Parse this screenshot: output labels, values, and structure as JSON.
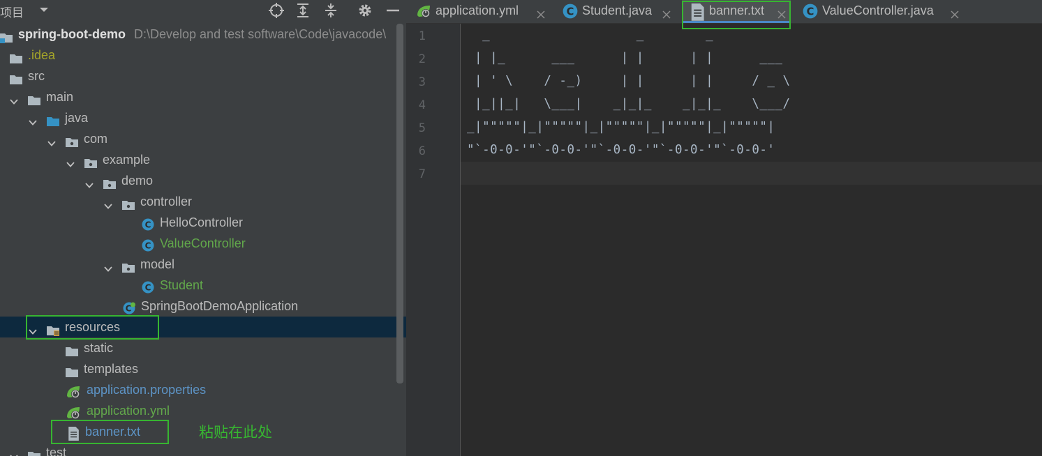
{
  "project_panel": {
    "title": "项目",
    "tree": [
      {
        "label": "spring-boot-demo",
        "path": "D:\\Develop and test software\\Code\\javacode\\",
        "icon": "module-folder-icon"
      },
      {
        "label": ".idea",
        "icon": "folder-icon"
      },
      {
        "label": "src",
        "icon": "folder-icon"
      },
      {
        "label": "main",
        "icon": "folder-icon"
      },
      {
        "label": "java",
        "icon": "source-folder-icon"
      },
      {
        "label": "com",
        "icon": "package-icon"
      },
      {
        "label": "example",
        "icon": "package-icon"
      },
      {
        "label": "demo",
        "icon": "package-icon"
      },
      {
        "label": "controller",
        "icon": "package-icon"
      },
      {
        "label": "HelloController",
        "icon": "class-icon"
      },
      {
        "label": "ValueController",
        "icon": "class-icon"
      },
      {
        "label": "model",
        "icon": "package-icon"
      },
      {
        "label": "Student",
        "icon": "class-icon"
      },
      {
        "label": "SpringBootDemoApplication",
        "icon": "spring-boot-class-icon"
      },
      {
        "label": "resources",
        "icon": "resources-folder-icon"
      },
      {
        "label": "static",
        "icon": "folder-icon"
      },
      {
        "label": "templates",
        "icon": "folder-icon"
      },
      {
        "label": "application.properties",
        "icon": "spring-config-icon"
      },
      {
        "label": "application.yml",
        "icon": "spring-config-icon"
      },
      {
        "label": "banner.txt",
        "icon": "text-file-icon"
      },
      {
        "label": "test",
        "icon": "folder-icon"
      }
    ],
    "annotation": "粘贴在此处"
  },
  "editor": {
    "tabs": [
      {
        "label": "application.yml",
        "icon": "spring-config-icon"
      },
      {
        "label": "Student.java",
        "icon": "class-icon"
      },
      {
        "label": "banner.txt",
        "icon": "text-file-icon",
        "active": true
      },
      {
        "label": "ValueController.java",
        "icon": "class-icon"
      }
    ],
    "line_numbers": [
      "1",
      "2",
      "3",
      "4",
      "5",
      "6",
      "7"
    ],
    "lines": [
      "  _                   _        _",
      " | |_      ___      | |      | |      ___",
      " | ' \\    / -_)     | |      | |     / _ \\",
      " |_||_|   \\___|    _|_|_    _|_|_    \\___/",
      "_|\"\"\"\"\"|_|\"\"\"\"\"|_|\"\"\"\"\"|_|\"\"\"\"\"|_|\"\"\"\"\"|",
      "\"`-0-0-'\"`-0-0-'\"`-0-0-'\"`-0-0-'\"`-0-0-'",
      ""
    ]
  },
  "colors": {
    "highlight_box": "#37b531",
    "panel_bg": "#3c3f41",
    "editor_bg": "#2b2b2b",
    "selection": "#0d293e"
  }
}
